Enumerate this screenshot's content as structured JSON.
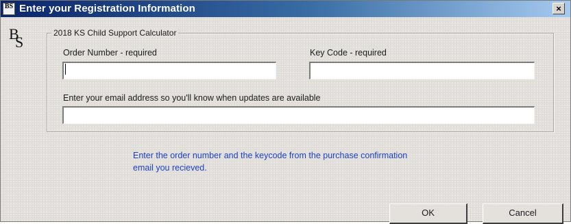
{
  "window": {
    "title": "Enter your Registration Information",
    "close_label": "×",
    "icon_letters": "BS"
  },
  "logo": {
    "letter_b": "B",
    "letter_s": "S"
  },
  "group": {
    "legend": "2018 KS Child Support Calculator"
  },
  "fields": {
    "order_number": {
      "label": "Order Number - required",
      "value": ""
    },
    "key_code": {
      "label": "Key Code - required",
      "value": ""
    },
    "email": {
      "label": "Enter your email address so you'll know when updates are available",
      "value": ""
    }
  },
  "info": {
    "line1": "Enter the order number and the keycode from the purchase confirmation",
    "line2": "email you recieved."
  },
  "buttons": {
    "ok": "OK",
    "cancel": "Cancel"
  },
  "colors": {
    "titlebar_start": "#0a246a",
    "titlebar_end": "#a6caf0",
    "info_text": "#1a3fc4"
  }
}
